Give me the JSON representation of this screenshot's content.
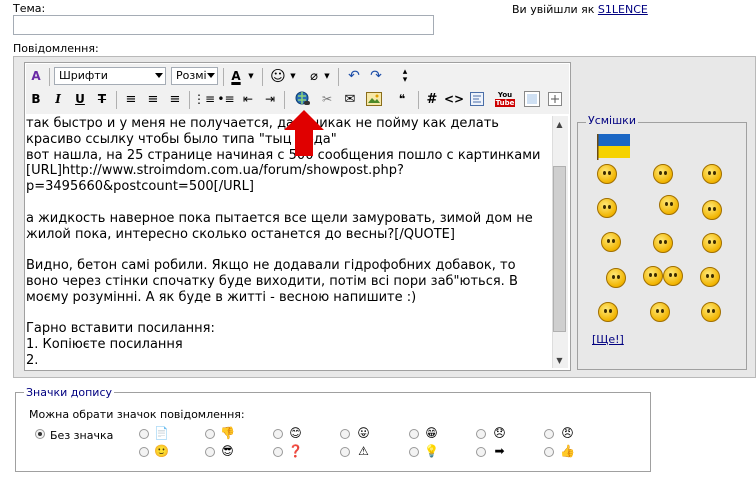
{
  "form": {
    "title_label": "Тема:",
    "message_label": "Повідомлення:",
    "login_prefix": "Ви увійшли як",
    "login_user": "S1LENCE"
  },
  "toolbar": {
    "font_select": "Шрифти",
    "size_select": "Розмі",
    "row1_icons": [
      "switch-mode-icon",
      "text-color-icon",
      "smiley-icon",
      "attach-icon",
      "undo-icon",
      "redo-icon",
      "resize-icon"
    ],
    "row2_icons": [
      "bold-icon",
      "italic-icon",
      "underline-icon",
      "strikethrough-icon",
      "align-left-icon",
      "align-center-icon",
      "align-right-icon",
      "ordered-list-icon",
      "unordered-list-icon",
      "outdent-icon",
      "indent-icon",
      "link-icon",
      "unlink-icon",
      "email-icon",
      "image-icon",
      "quote-icon",
      "hash-icon",
      "code-icon",
      "php-icon",
      "youtube-icon",
      "picture-icon",
      "more-icon"
    ],
    "youtube_label": "You Tube"
  },
  "editor": {
    "lines": [
      "так быстро и у меня не получается, да и никак не пойму как делать",
      "красиво ссылку чтобы было типа \"тыц сюда\"",
      "вот нашла, на 25 странице начиная с 500 сообщения пошло с картинками",
      "[URL]http://www.stroimdom.com.ua/forum/showpost.php?",
      "p=3495660&postcount=500[/URL]",
      "",
      "а жидкость наверное пока пытается все щели замуровать, зимой дом не",
      "жилой пока, интересно сколько останется до весны?[/QUOTE]",
      "",
      "Видно, бетон самі робили. Якщо не додавали гідрофобних добавок, то",
      "воно через стінки спочатку буде виходити, потім всі пори заб\"ються. В",
      "моєму розумінні. А як буде в житті - весною напишите :)",
      "",
      "Гарно вставити посилання:",
      "1. Копіюєте посилання",
      "2."
    ]
  },
  "smiles": {
    "legend": "Усмішки",
    "more_link": "[Ще!]"
  },
  "post_icons": {
    "legend": "Значки допису",
    "prompt": "Можна обрати значок повідомлення:",
    "no_icon_label": "Без значка",
    "icons_row1": [
      "document-icon",
      "thumbs-down-icon",
      "happy-icon",
      "tongue-icon",
      "grin-icon",
      "sad-icon",
      "angry-icon"
    ],
    "icons_row2": [
      "smile-icon",
      "cool-icon",
      "question-icon",
      "warning-icon",
      "lightbulb-icon",
      "arrow-right-icon",
      "thumbs-up-icon"
    ]
  },
  "colors": {
    "link": "#000080",
    "panel_bg": "#e8e8e8",
    "arrow": "#e00000"
  }
}
